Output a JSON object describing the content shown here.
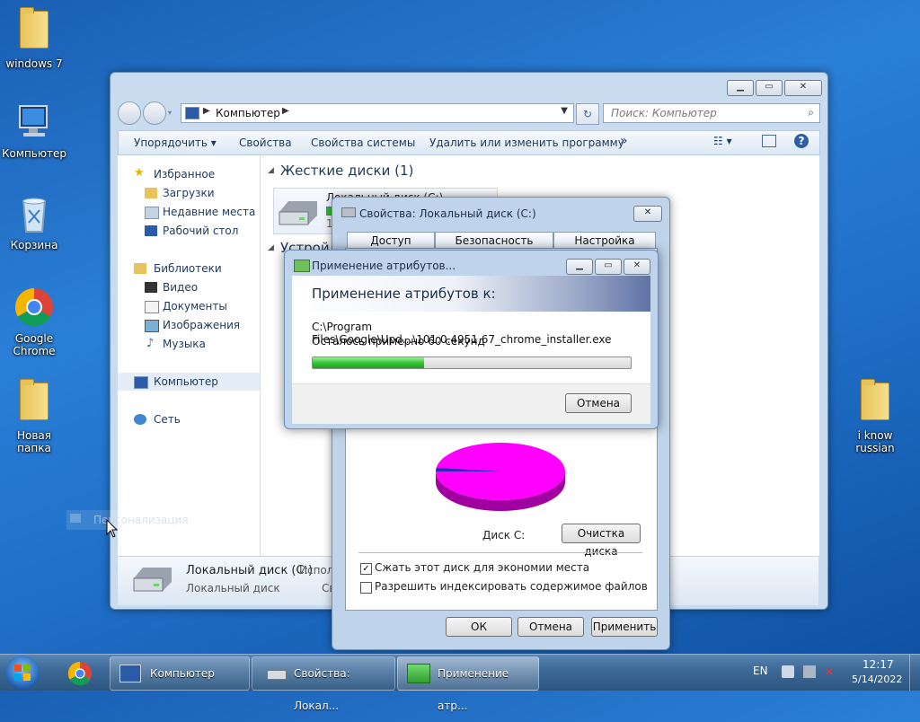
{
  "desktop": {
    "icons": [
      {
        "label": "windows 7"
      },
      {
        "label": "Компьютер"
      },
      {
        "label": "Корзина"
      },
      {
        "label": "Google Chrome"
      },
      {
        "label": "Новая папка"
      },
      {
        "label": "i know russian"
      }
    ],
    "ghost_label": "Персонализация"
  },
  "explorer": {
    "address": [
      "Компьютер"
    ],
    "search_placeholder": "Поиск: Компьютер",
    "toolbar": {
      "organize": "Упорядочить",
      "properties": "Свойства",
      "system_properties": "Свойства системы",
      "uninstall": "Удалить или изменить программу",
      "more": "»"
    },
    "nav": {
      "favorites": "Избранное",
      "downloads": "Загрузки",
      "recent": "Недавние места",
      "desktop": "Рабочий стол",
      "libraries": "Библиотеки",
      "video": "Видео",
      "documents": "Документы",
      "images": "Изображения",
      "music": "Музыка",
      "computer": "Компьютер",
      "network": "Сеть"
    },
    "content": {
      "hard_drives_group": "Жесткие диски (1)",
      "drive_name": "Локальный диск (C:)",
      "drive_size_prefix": "15",
      "devices_group": "Устрой"
    },
    "details": {
      "name": "Локальный диск (C:)",
      "type": "Локальный диск",
      "used_prefix": "Испол",
      "free_prefix": "Св"
    }
  },
  "properties_dialog": {
    "title": "Свойства: Локальный диск (C:)",
    "tabs": [
      "Доступ",
      "Безопасность",
      "Настройка"
    ],
    "disk_label": "Диск C:",
    "cleanup_button": "Очистка диска",
    "compress_checkbox": {
      "label": "Сжать этот диск для экономии места",
      "checked": true
    },
    "index_checkbox": {
      "label": "Разрешить индексировать содержимое файлов",
      "checked": false
    },
    "buttons": {
      "ok": "ОК",
      "cancel": "Отмена",
      "apply": "Применить"
    },
    "pie": {
      "used_fraction": 0.02,
      "used_color": "#2a2ab8",
      "free_color": "#ff00ff"
    }
  },
  "apply_dialog": {
    "title": "Применение атрибутов...",
    "heading": "Применение атрибутов к:",
    "path": "C:\\Program Files\\Google\\Upd...\\101.0.4951.67_chrome_installer.exe",
    "remaining": "Осталось примерно 60 секунд",
    "progress": 0.35,
    "cancel": "Отмена"
  },
  "taskbar": {
    "tasks": [
      {
        "label": "Компьютер"
      },
      {
        "label": "Свойства: Локал..."
      },
      {
        "label": "Применение атр..."
      }
    ],
    "language": "EN",
    "time": "12:17",
    "date": "5/14/2022"
  }
}
